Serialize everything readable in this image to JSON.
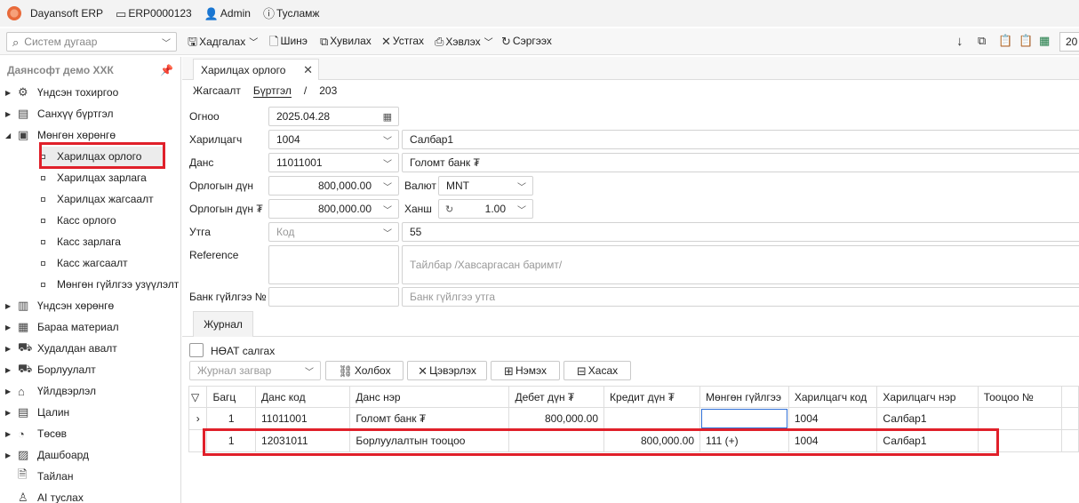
{
  "titlebar": {
    "app_name": "Dayansoft ERP",
    "db_name": "ERP0000123",
    "user": "Admin",
    "help": "Тусламж"
  },
  "toolbar": {
    "search_placeholder": "Систем дугаар",
    "save": "Хадгалах",
    "new": "Шинэ",
    "copy": "Хувилах",
    "delete": "Устгах",
    "print": "Хэвлэх",
    "refresh": "Сэргээх",
    "page_value": "20"
  },
  "sidebar": {
    "company": "Даянсофт демо ХХК",
    "items": [
      {
        "label": "Үндсэн тохиргоо",
        "icon": "gear-icon"
      },
      {
        "label": "Санхүү бүртгэл",
        "icon": "ledger-icon"
      },
      {
        "label": "Мөнгөн хөрөнгө",
        "icon": "cash-icon"
      }
    ],
    "subitems": [
      "Харилцах орлого",
      "Харилцах зарлага",
      "Харилцах жагсаалт",
      "Касс орлого",
      "Касс зарлага",
      "Касс жагсаалт",
      "Мөнгөн гүйлгээ узүүлэлт"
    ],
    "items2": [
      {
        "label": "Үндсэн хөрөнгө",
        "icon": "building-icon"
      },
      {
        "label": "Бараа материал",
        "icon": "box-icon"
      },
      {
        "label": "Худалдан авалт",
        "icon": "cart-icon"
      },
      {
        "label": "Борлуулалт",
        "icon": "sales-cart-icon"
      },
      {
        "label": "Үйлдвэрлэл",
        "icon": "factory-icon"
      },
      {
        "label": "Цалин",
        "icon": "calculator-icon"
      },
      {
        "label": "Төсөв",
        "icon": "pie-chart-icon"
      },
      {
        "label": "Дашбоард",
        "icon": "dashboard-icon"
      },
      {
        "label": "Тайлан",
        "icon": "report-icon"
      },
      {
        "label": "AI туслах",
        "icon": "ai-icon"
      }
    ]
  },
  "tab": {
    "title": "Харилцах орлого"
  },
  "breadcrumb": {
    "list": "Жагсаалт",
    "register": "Бүртгэл",
    "sep": "/",
    "number": "203"
  },
  "form": {
    "date_label": "Огноо",
    "date_value": "2025.04.28",
    "partner_label": "Харилцагч",
    "partner_code": "1004",
    "partner_name": "Салбар1",
    "account_label": "Данс",
    "account_code": "11011001",
    "account_name": "Голомт банк ₮",
    "amount_label": "Орлогын дүн",
    "amount_value": "800,000.00",
    "currency_label": "Валют",
    "currency_value": "MNT",
    "amount_mnt_label": "Орлогын дүн ₮",
    "amount_mnt_value": "800,000.00",
    "rate_label": "Ханш",
    "rate_value": "1.00",
    "flow_label": "Утга",
    "flow_placeholder": "Код",
    "flow_value": "55",
    "reference_label": "Reference",
    "note_placeholder": "Тайлбар /Хавсаргасан баримт/",
    "bank_txn_label": "Банк гүйлгээ №",
    "bank_txn_placeholder": "Банк гүйлгээ утга"
  },
  "journal": {
    "tab_label": "Журнал",
    "vat_label": "НӨАТ салгах",
    "template_placeholder": "Журнал загвар",
    "link_btn": "Холбох",
    "clear_btn": "Цэвэрлэх",
    "add_btn": "Нэмэх",
    "remove_btn": "Хасах",
    "columns": [
      "Багц",
      "Данс код",
      "Данс нэр",
      "Дебет дүн ₮",
      "Кредит дүн ₮",
      "Мөнгөн гүйлгээ",
      "Харилцагч код",
      "Харилцагч нэр",
      "Тооцоо №"
    ],
    "rows": [
      {
        "batch": "1",
        "account_code": "11011001",
        "account_name": "Голомт банк ₮",
        "debit": "800,000.00",
        "credit": "",
        "cashflow": "",
        "partner_code": "1004",
        "partner_name": "Салбар1",
        "settle": ""
      },
      {
        "batch": "1",
        "account_code": "12031011",
        "account_name": "Борлуулалтын тооцоо",
        "debit": "",
        "credit": "800,000.00",
        "cashflow": "111 (+)",
        "partner_code": "1004",
        "partner_name": "Салбар1",
        "settle": ""
      }
    ]
  }
}
